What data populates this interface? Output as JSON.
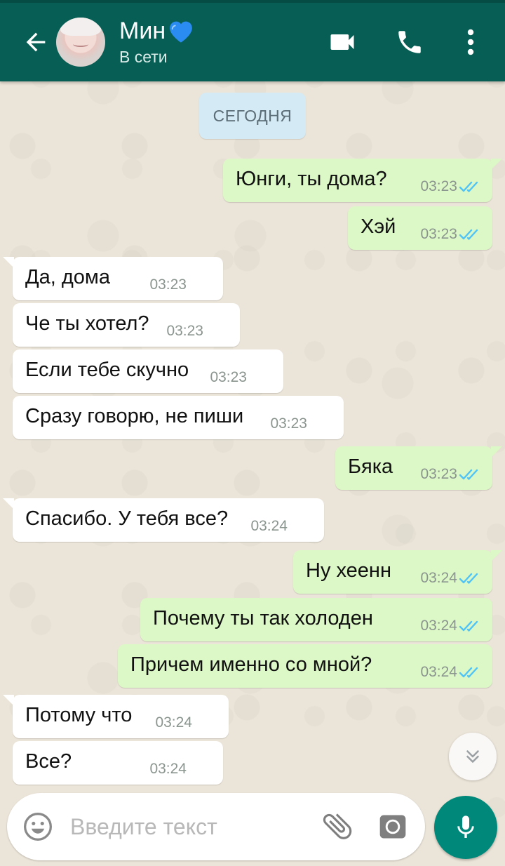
{
  "header": {
    "contact_name": "Мин",
    "heart_emoji": "💙",
    "status": "В сети",
    "icons": [
      "back-arrow-icon",
      "video-call-icon",
      "phone-icon",
      "more-vert-icon"
    ],
    "bar_color": "#075e54"
  },
  "chat": {
    "date_chip": "СЕГОДНЯ",
    "messages": [
      {
        "dir": "out",
        "text": "Юнги, ты дома?",
        "time": "03:23",
        "read": true
      },
      {
        "dir": "out",
        "text": "Хэй",
        "time": "03:23",
        "read": true
      },
      {
        "dir": "in",
        "text": "Да, дома",
        "time": "03:23"
      },
      {
        "dir": "in",
        "text": "Че ты хотел?",
        "time": "03:23"
      },
      {
        "dir": "in",
        "text": "Если тебе скучно",
        "time": "03:23"
      },
      {
        "dir": "in",
        "text": "Сразу говорю, не пиши",
        "time": "03:23"
      },
      {
        "dir": "out",
        "text": "Бяка",
        "time": "03:23",
        "read": true
      },
      {
        "dir": "in",
        "text": "Спасибо. У тебя все?",
        "time": "03:24"
      },
      {
        "dir": "out",
        "text": "Ну хеенн",
        "time": "03:24",
        "read": true
      },
      {
        "dir": "out",
        "text": "Почему ты так холоден",
        "time": "03:24",
        "read": true
      },
      {
        "dir": "out",
        "text": "Причем именно со мной?",
        "time": "03:24",
        "read": true
      },
      {
        "dir": "in",
        "text": "Потому что",
        "time": "03:24"
      },
      {
        "dir": "in",
        "text": "Все?",
        "time": "03:24"
      }
    ],
    "colors": {
      "outgoing": "#dcf8c6",
      "incoming": "#ffffff",
      "read_ticks": "#4fc3f7"
    }
  },
  "composer": {
    "placeholder": "Введите текст",
    "icons": [
      "emoji-icon",
      "paperclip-icon",
      "camera-icon",
      "mic-icon",
      "chevron-double-down-icon"
    ],
    "accent": "#00897b"
  }
}
